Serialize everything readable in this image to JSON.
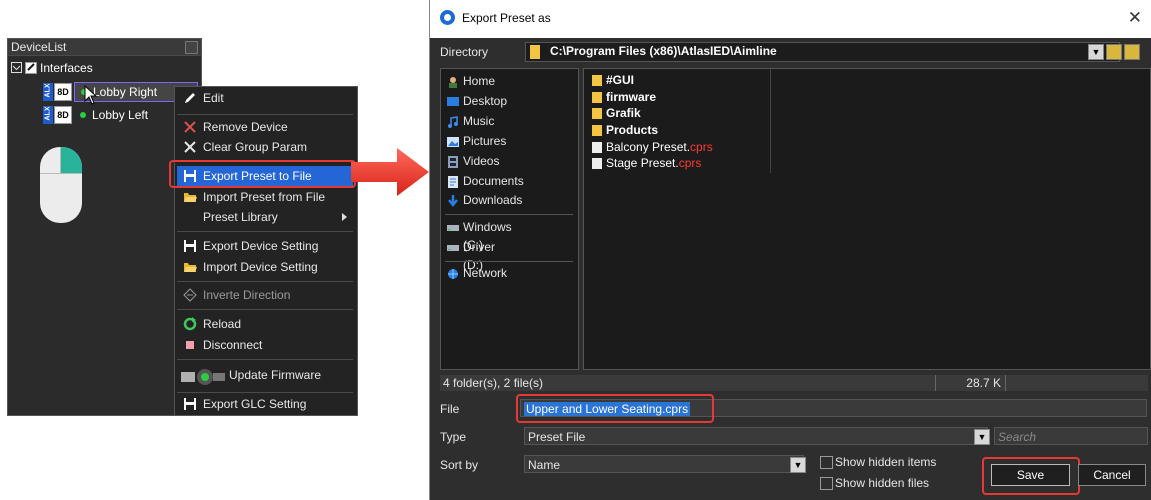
{
  "device_list": {
    "title": "DeviceList",
    "root_label": "Interfaces",
    "devices": [
      {
        "badge_top": "ALX",
        "badge_code": "8D",
        "name": "Lobby Right",
        "status_color": "#2ecc40"
      },
      {
        "badge_top": "ALX",
        "badge_code": "8D",
        "name": "Lobby Left",
        "status_color": "#2ecc40"
      }
    ]
  },
  "context_menu": {
    "items": [
      {
        "label": "Edit",
        "icon": "pencil-icon"
      },
      {
        "label": "Remove Device",
        "icon": "x-icon"
      },
      {
        "label": "Clear Group Param",
        "icon": "x-icon"
      },
      {
        "label": "Export Preset to File",
        "icon": "floppy-icon",
        "highlighted": true
      },
      {
        "label": "Import Preset from File",
        "icon": "open-folder-icon"
      },
      {
        "label": "Preset Library",
        "icon": "",
        "submenu": true
      },
      {
        "label": "Export Device Setting",
        "icon": "floppy-icon"
      },
      {
        "label": "Import Device Setting",
        "icon": "open-folder-icon"
      },
      {
        "label": "Inverte Direction",
        "icon": "invert-icon",
        "disabled": true
      },
      {
        "label": "Reload",
        "icon": "reload-icon"
      },
      {
        "label": "Disconnect",
        "icon": "stop-icon"
      },
      {
        "label": "Update Firmware",
        "icon": "firmware-icon"
      },
      {
        "label": "Export GLC Setting",
        "icon": "floppy-icon"
      }
    ]
  },
  "dialog": {
    "title": "Export Preset as",
    "close_glyph": "✕",
    "directory_label": "Directory",
    "directory_value": "C:\\Program Files (x86)\\AtlasIED\\Aimline",
    "places": [
      {
        "label": "Home",
        "icon": "home-icon"
      },
      {
        "label": "Desktop",
        "icon": "desktop-icon"
      },
      {
        "label": "Music",
        "icon": "music-icon"
      },
      {
        "label": "Pictures",
        "icon": "pictures-icon"
      },
      {
        "label": "Videos",
        "icon": "videos-icon"
      },
      {
        "label": "Documents",
        "icon": "documents-icon"
      },
      {
        "label": "Downloads",
        "icon": "downloads-icon"
      },
      {
        "label": "Windows (C:)",
        "icon": "drive-icon"
      },
      {
        "label": "Driver (D:)",
        "icon": "drive-icon"
      },
      {
        "label": "Network",
        "icon": "network-icon"
      }
    ],
    "files": [
      {
        "name": "#GUI",
        "ext": "",
        "type": "folder"
      },
      {
        "name": "firmware",
        "ext": "",
        "type": "folder"
      },
      {
        "name": "Grafik",
        "ext": "",
        "type": "folder"
      },
      {
        "name": "Products",
        "ext": "",
        "type": "folder"
      },
      {
        "name": "Balcony Preset.",
        "ext": "cprs",
        "type": "file"
      },
      {
        "name": "Stage Preset.",
        "ext": "cprs",
        "type": "file"
      }
    ],
    "status_count": "4 folder(s), 2 file(s)",
    "status_size": "28.7 K",
    "file_label": "File",
    "file_value": "Upper and Lower Seating.cprs",
    "type_label": "Type",
    "type_value": "Preset File",
    "search_placeholder": "Search",
    "sortby_label": "Sort by",
    "sortby_value": "Name",
    "show_hidden_items": "Show hidden items",
    "show_hidden_files": "Show hidden files",
    "save_label": "Save",
    "cancel_label": "Cancel"
  },
  "colors": {
    "accent_highlight": "#2566d6",
    "callout_red": "#e53935",
    "folder_yellow": "#f4c542",
    "extension_red": "#ff3b30"
  }
}
